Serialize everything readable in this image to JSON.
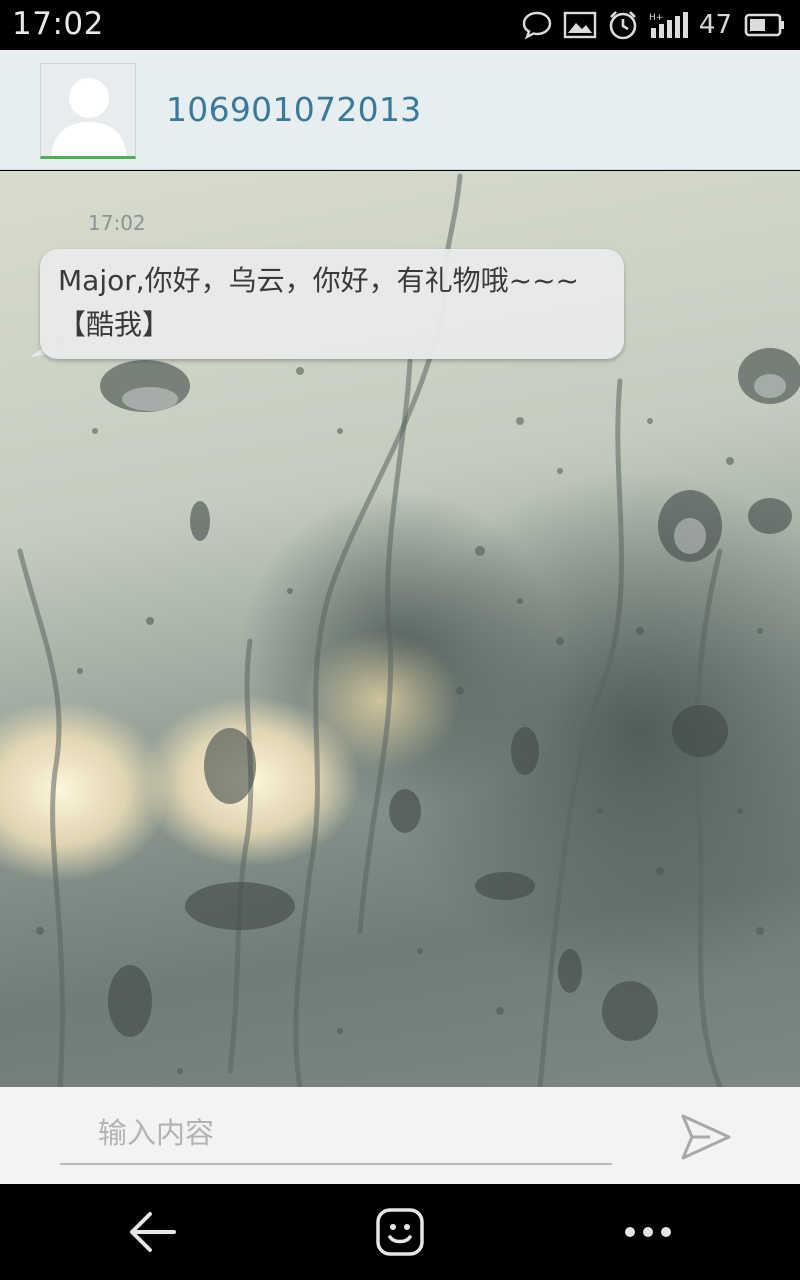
{
  "status_bar": {
    "time": "17:02",
    "battery_level": "47",
    "icons": [
      "chat-bubble-icon",
      "image-icon",
      "alarm-clock-icon",
      "signal-icon",
      "battery-icon"
    ]
  },
  "header": {
    "contact_name": "106901072013",
    "avatar_icon": "person-silhouette-icon"
  },
  "conversation": {
    "messages": [
      {
        "time": "17:02",
        "text": "Major,你好，乌云，你好，有礼物哦~~~【酷我】",
        "direction": "incoming"
      }
    ],
    "background": "rain-on-glass wallpaper"
  },
  "composer": {
    "placeholder": "输入内容",
    "value": "",
    "send_icon": "send-arrow-icon"
  },
  "nav_bar": {
    "buttons": [
      "back-arrow-icon",
      "emoji-icon",
      "more-dots-icon"
    ]
  },
  "colors": {
    "header_bg": "#e6eef1",
    "contact_name": "#3a7a98",
    "avatar_accent": "#4caf50",
    "bubble_bg": "#e8e9eb",
    "input_bg": "#f3f3f3"
  }
}
